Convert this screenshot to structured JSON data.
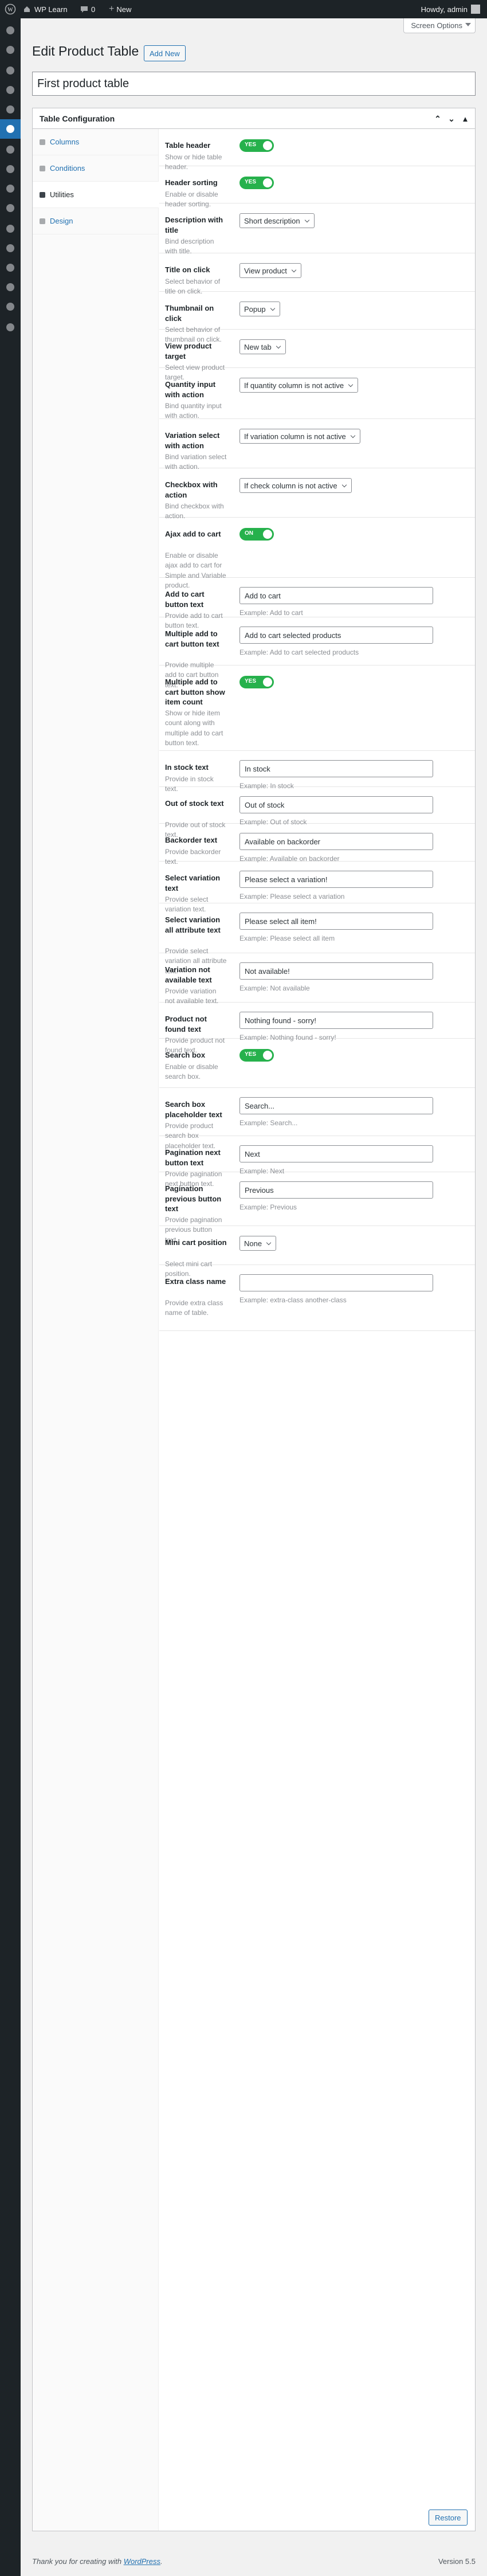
{
  "admin_bar": {
    "site_name": "WP Learn",
    "comments_count": "0",
    "new_label": "New",
    "howdy": "Howdy, admin"
  },
  "header": {
    "screen_options": "Screen Options",
    "title": "Edit Product Table",
    "add_new": "Add New"
  },
  "post_title": "First product table",
  "box": {
    "title": "Table Configuration",
    "tabs": [
      "Columns",
      "Conditions",
      "Utilities",
      "Design"
    ],
    "active_tab": "Utilities"
  },
  "fields": [
    {
      "label": "Table header",
      "desc": "Show or hide table header.",
      "type": "toggle",
      "value": "YES"
    },
    {
      "label": "Header sorting",
      "desc": "Enable or disable header sorting.",
      "type": "toggle",
      "value": "YES"
    },
    {
      "label": "Description with title",
      "desc": "Bind description with title.",
      "type": "select",
      "value": "Short description"
    },
    {
      "label": "Title on click",
      "desc": "Select behavior of title on click.",
      "type": "select",
      "value": "View product"
    },
    {
      "label": "Thumbnail on click",
      "desc": "Select behavior of thumbnail on click.",
      "type": "select",
      "value": "Popup"
    },
    {
      "label": "View product target",
      "desc": "Select view product target.",
      "type": "select",
      "value": "New tab"
    },
    {
      "label": "Quantity input with action",
      "desc": "Bind quantity input with action.",
      "type": "select",
      "value": "If quantity column is not active"
    },
    {
      "label": "Variation select with action",
      "desc": "Bind variation select with action.",
      "type": "select",
      "value": "If variation column is not active"
    },
    {
      "label": "Checkbox with action",
      "desc": "Bind checkbox with action.",
      "type": "select",
      "value": "If check column is not active"
    },
    {
      "label": "Ajax add to cart",
      "desc": "Enable or disable ajax add to cart for Simple and Variable product.",
      "type": "toggle",
      "value": "ON"
    },
    {
      "label": "Add to cart button text",
      "desc": "Provide add to cart button text.",
      "type": "text",
      "value": "Add to cart",
      "example": "Example: Add to cart"
    },
    {
      "label": "Multiple add to cart button text",
      "desc": "Provide multiple add to cart button text.",
      "type": "text",
      "value": "Add to cart selected products",
      "example": "Example: Add to cart selected products"
    },
    {
      "label": "Multiple add to cart button show item count",
      "desc": "Show or hide item count along with multiple add to cart button text.",
      "type": "toggle",
      "value": "YES"
    },
    {
      "label": "In stock text",
      "desc": "Provide in stock text.",
      "type": "text",
      "value": "In stock",
      "example": "Example: In stock"
    },
    {
      "label": "Out of stock text",
      "desc": "Provide out of stock text.",
      "type": "text",
      "value": "Out of stock",
      "example": "Example: Out of stock"
    },
    {
      "label": "Backorder text",
      "desc": "Provide backorder text.",
      "type": "text",
      "value": "Available on backorder",
      "example": "Example: Available on backorder"
    },
    {
      "label": "Select variation text",
      "desc": "Provide select variation text.",
      "type": "text",
      "value": "Please select a variation!",
      "example": "Example: Please select a variation"
    },
    {
      "label": "Select variation all attribute text",
      "desc": "Provide select variation all attribute text.",
      "type": "text",
      "value": "Please select all item!",
      "example": "Example: Please select all item"
    },
    {
      "label": "Variation not available text",
      "desc": "Provide variation not available text.",
      "type": "text",
      "value": "Not available!",
      "example": "Example: Not available"
    },
    {
      "label": "Product not found text",
      "desc": "Provide product not found text.",
      "type": "text",
      "value": "Nothing found - sorry!",
      "example": "Example: Nothing found - sorry!"
    },
    {
      "label": "Search box",
      "desc": "Enable or disable search box.",
      "type": "toggle",
      "value": "YES"
    },
    {
      "label": "Search box placeholder text",
      "desc": "Provide product search box placeholder text.",
      "type": "text",
      "value": "Search...",
      "example": "Example: Search..."
    },
    {
      "label": "Pagination next button text",
      "desc": "Provide pagination next button text.",
      "type": "text",
      "value": "Next",
      "example": "Example: Next"
    },
    {
      "label": "Pagination previous button text",
      "desc": "Provide pagination previous button text.",
      "type": "text",
      "value": "Previous",
      "example": "Example: Previous"
    },
    {
      "label": "Mini cart position",
      "desc": "Select mini cart position.",
      "type": "select",
      "value": "None"
    },
    {
      "label": "Extra class name",
      "desc": "Provide extra class name of table.",
      "type": "text",
      "value": "",
      "example": "Example: extra-class another-class"
    }
  ],
  "restore_label": "Restore",
  "footer": {
    "thanks_prefix": "Thank you for creating with ",
    "thanks_link": "WordPress",
    "thanks_suffix": ".",
    "version": "Version 5.5"
  },
  "colors": {
    "admin_bar": "#1d2327",
    "menu_current": "#2271b1",
    "toggle_on": "#26b14c",
    "link": "#2271b1"
  },
  "icons": {
    "admin_menu": [
      "dashboard-icon",
      "posts-icon",
      "media-icon",
      "pages-icon",
      "comments-icon",
      "product-table-icon",
      "woocommerce-icon",
      "products-icon",
      "analytics-icon",
      "marketing-icon",
      "appearance-icon",
      "plugins-icon",
      "users-icon",
      "tools-icon",
      "settings-icon",
      "collapse-icon"
    ]
  }
}
